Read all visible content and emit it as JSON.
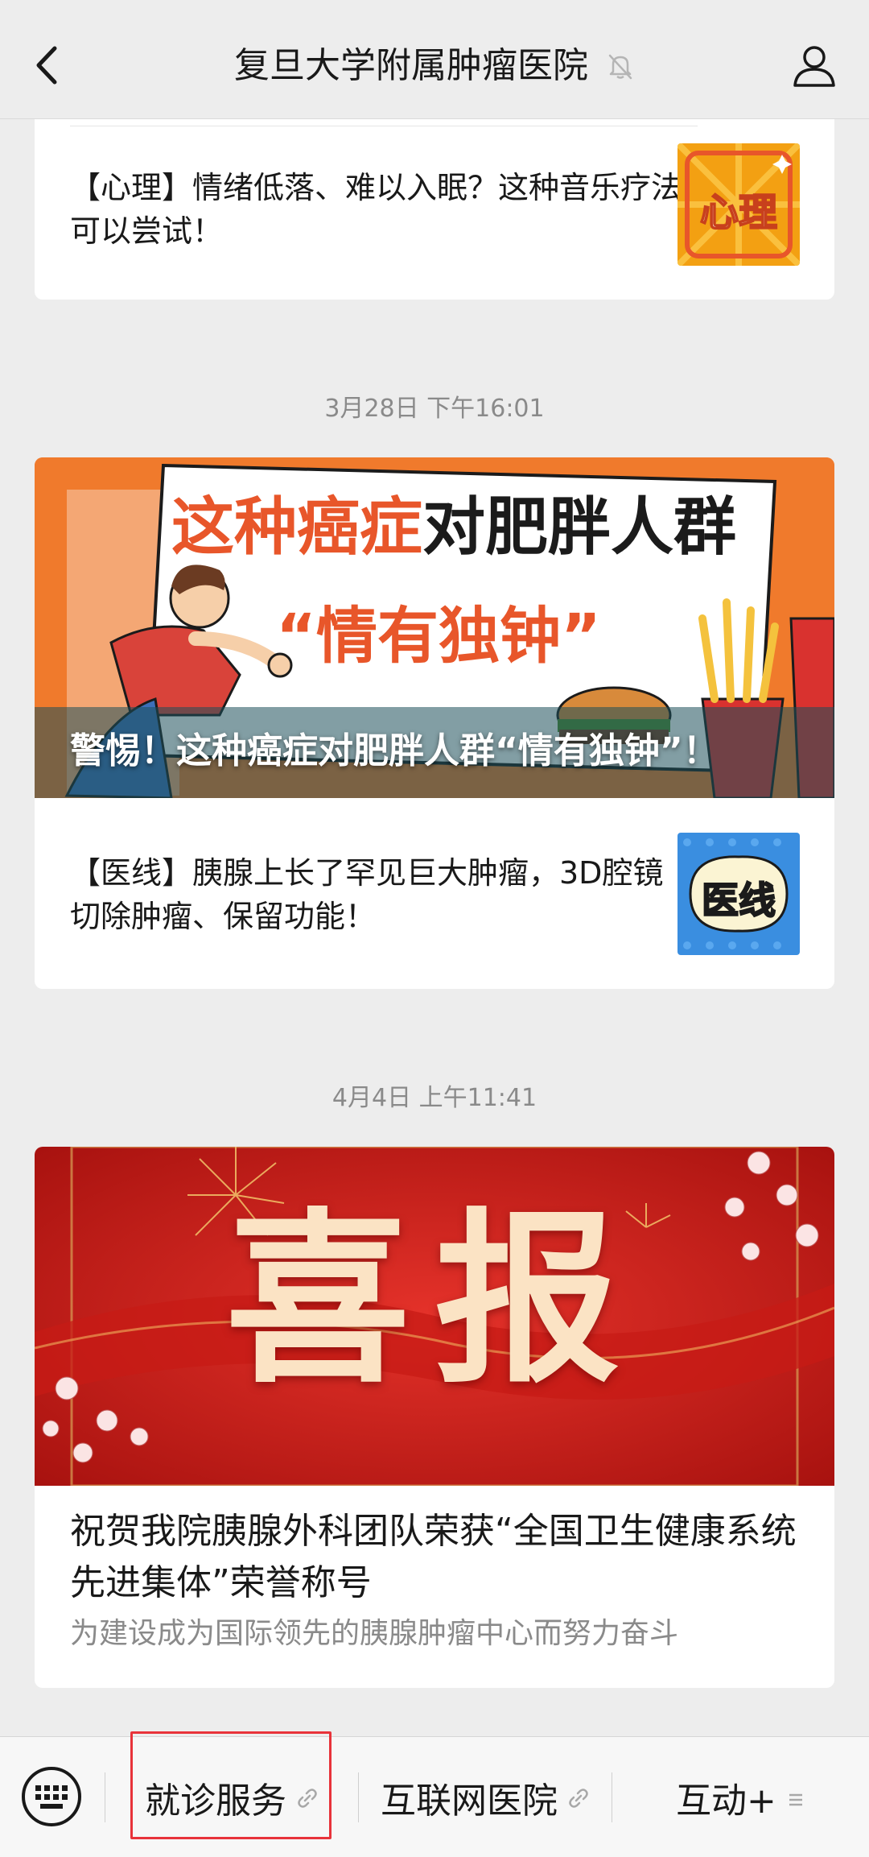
{
  "nav": {
    "title": "复旦大学附属肿瘤医院",
    "back_icon": "chevron-left-icon",
    "mute_icon": "bell-off-icon",
    "profile_icon": "user-icon"
  },
  "feed": {
    "card1": {
      "row_text": "【心理】情绪低落、难以入眠？这种音乐疗法可以尝试！",
      "thumb_label": "心理",
      "thumb_colors": [
        "#f7b21b",
        "#e8562a"
      ]
    },
    "timestamp1": "3月28日 下午16:01",
    "card2": {
      "hero_line1_red": "这种癌症",
      "hero_line1_black": "对肥胖人群",
      "hero_line2": "“情有独钟”",
      "hero_caption": "警惕！这种癌症对肥胖人群“情有独钟”！",
      "row_text": "【医线】胰腺上长了罕见巨大肿瘤，3D腔镜切除肿瘤、保留功能！",
      "thumb_label": "医线"
    },
    "timestamp2": "4月4日 上午11:41",
    "card3": {
      "hero_text": "喜报",
      "title": "祝贺我院胰腺外科团队荣获“全国卫生健康系统先进集体”荣誉称号",
      "subtitle": "为建设成为国际领先的胰腺肿瘤中心而努力奋斗"
    }
  },
  "menu": {
    "keyboard_icon": "keyboard-icon",
    "items": [
      {
        "label": "就诊服务",
        "icon": "link-icon"
      },
      {
        "label": "互联网医院",
        "icon": "link-icon"
      },
      {
        "label": "互动+",
        "icon": "menu-lines-icon"
      }
    ]
  },
  "colors": {
    "background": "#ededed",
    "card": "#ffffff",
    "highlight": "#e8333a",
    "secondary_text": "#8a8a8a"
  }
}
